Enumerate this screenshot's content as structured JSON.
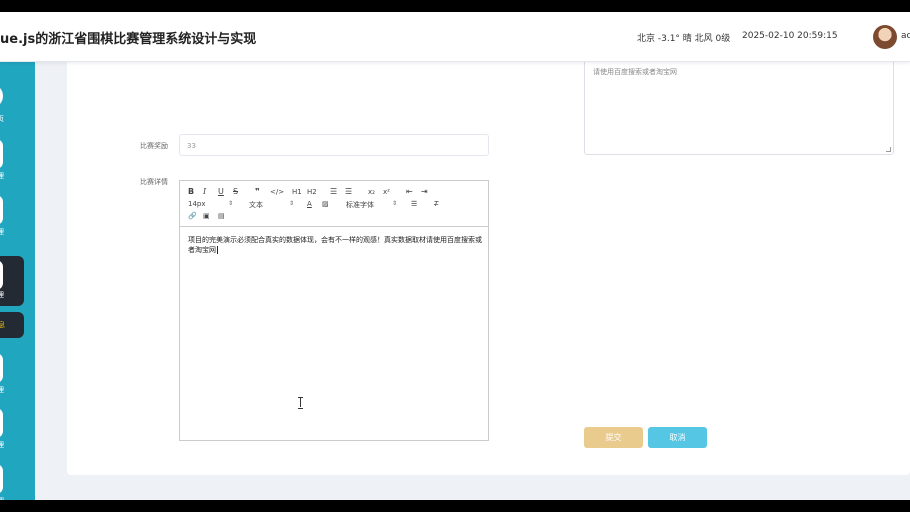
{
  "header": {
    "title": "ue.js的浙江省围棋比赛管理系统设计与实现",
    "weather": "北京  -3.1°  晴  北风  0级",
    "datetime": "2025-02-10 20:59:15",
    "user": "ac"
  },
  "sidebar": {
    "items": [
      {
        "label": "页",
        "icon": "home-icon"
      },
      {
        "label": "理",
        "icon": "menu-icon"
      },
      {
        "label": "管理",
        "icon": "menu-icon"
      },
      {
        "label": "管理",
        "icon": "menu-icon",
        "active": true
      },
      {
        "label": "理",
        "icon": "menu-icon"
      },
      {
        "label": "管理",
        "icon": "menu-icon"
      },
      {
        "label": "管理",
        "icon": "menu-icon"
      }
    ],
    "sub_item": "息"
  },
  "form": {
    "description_preview": "请使用百度搜索或者淘宝网",
    "reward_label": "比赛奖励",
    "reward_value": "33",
    "detail_label": "比赛详情",
    "editor_toolbar": {
      "font_size": "14px",
      "block_format": "文本",
      "font_family": "标准字体",
      "h1": "H1",
      "h2": "H2",
      "sub": "x₂",
      "sup": "x²"
    },
    "detail_content": "项目的完美演示必须配合真实的数据体现，会有不一样的观感！真实数据取材请使用百度搜索或者淘宝网",
    "submit_label": "提交",
    "cancel_label": "取消"
  },
  "colors": {
    "sidebar": "#21a6c0",
    "active_nav": "#232a33",
    "submit": "#eacb8e",
    "cancel": "#55c6e3"
  }
}
